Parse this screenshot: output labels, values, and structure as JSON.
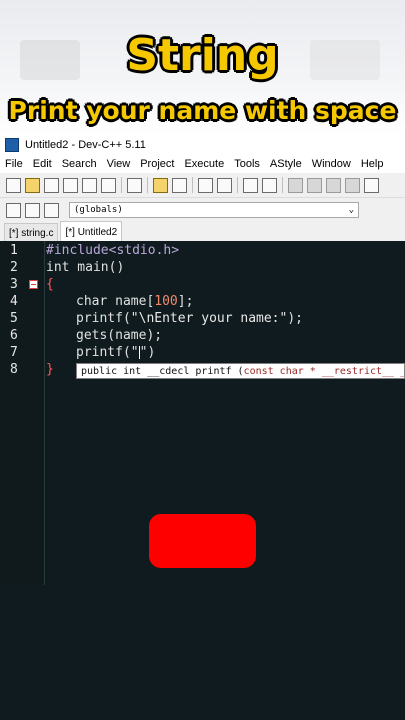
{
  "overlay": {
    "title": "String",
    "subtitle": "Print your name with space"
  },
  "window": {
    "title": "Untitled2 - Dev-C++ 5.11"
  },
  "menu": [
    "File",
    "Edit",
    "Search",
    "View",
    "Project",
    "Execute",
    "Tools",
    "AStyle",
    "Window",
    "Help"
  ],
  "toolbar2": {
    "scope_value": "(globals)"
  },
  "tabs": [
    {
      "label": "[*] string.c"
    },
    {
      "label": "[*] Untitled2"
    }
  ],
  "code": {
    "line_numbers": [
      "1",
      "2",
      "3",
      "4",
      "5",
      "6",
      "7",
      "8"
    ],
    "l1": "#include<stdio.h>",
    "l2": "int main()",
    "l3": "{",
    "l4_kw": "char",
    "l4_mid": " name[",
    "l4_num": "100",
    "l4_end": "];",
    "l5_fn": "printf(",
    "l5_str": "\"\\nEnter your name:\"",
    "l5_end": ");",
    "l6": "gets(name);",
    "l7_a": "printf(\"",
    "l7_b": "\")",
    "l8": "}"
  },
  "tooltip": {
    "text_a": "public int __cdecl printf (",
    "text_b": "const char * __restrict__ _F"
  },
  "colors": {
    "title_yellow": "#f5c800",
    "editor_bg": "#0f1b1e",
    "play_button_red": "#ff0000"
  },
  "icons": [
    "dev-cpp-app-icon",
    "new-file-icon",
    "open-icon",
    "save-icon",
    "save-all-icon",
    "close-icon",
    "close-all-icon",
    "print-icon",
    "undo-icon",
    "redo-icon",
    "find-icon",
    "replace-icon",
    "goto-icon",
    "indent-icon",
    "compile-icon",
    "run-icon",
    "class-icon",
    "function-icon",
    "bookmark-icon",
    "dropdown-arrow-icon"
  ]
}
